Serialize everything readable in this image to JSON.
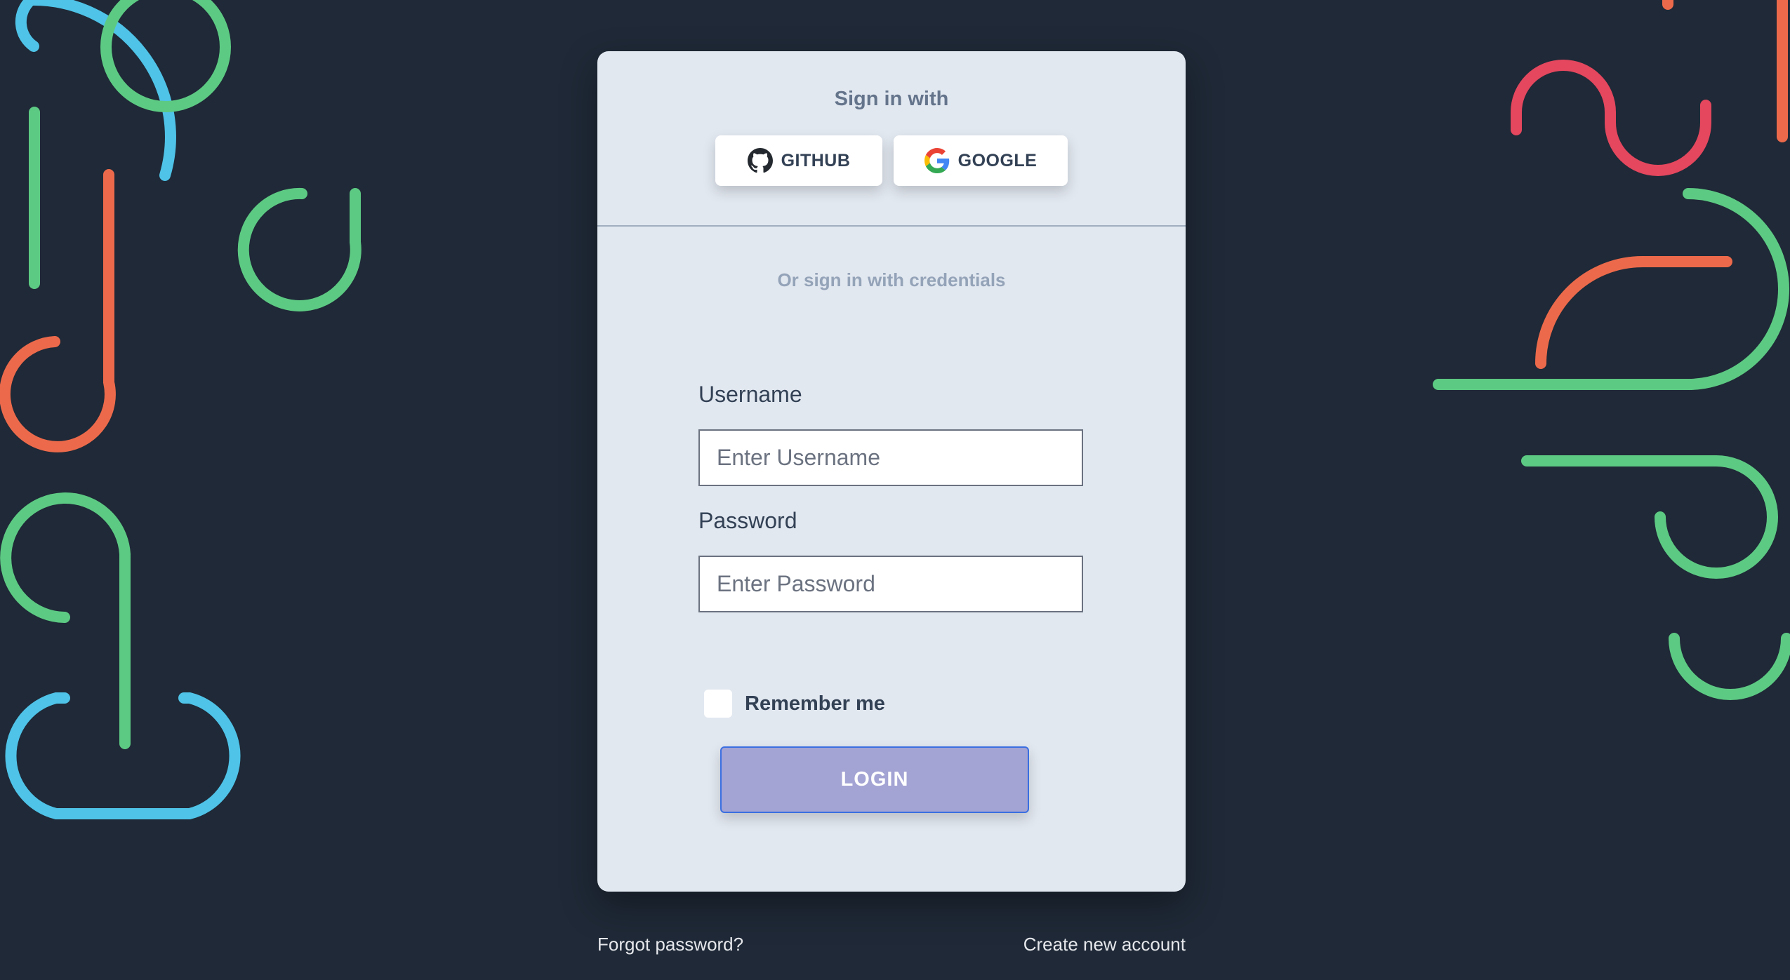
{
  "social": {
    "title": "Sign in with",
    "buttons": [
      {
        "label": "GITHUB",
        "icon": "github-icon"
      },
      {
        "label": "GOOGLE",
        "icon": "google-icon"
      }
    ]
  },
  "credentials": {
    "title": "Or sign in with credentials",
    "username": {
      "label": "Username",
      "placeholder": "Enter Username",
      "value": ""
    },
    "password": {
      "label": "Password",
      "placeholder": "Enter Password",
      "value": ""
    },
    "remember": {
      "label": "Remember me",
      "checked": false
    },
    "login_label": "LOGIN"
  },
  "footer": {
    "forgot": "Forgot password?",
    "create": "Create new account"
  },
  "colors": {
    "background": "#1f2937",
    "card": "#e2e8f0",
    "login_button": "#a3a3d4",
    "login_border": "#3b6fe0",
    "deco_green": "#5dca83",
    "deco_blue": "#4fc3e8",
    "deco_orange": "#ec6a4b",
    "deco_red": "#e4475e"
  }
}
